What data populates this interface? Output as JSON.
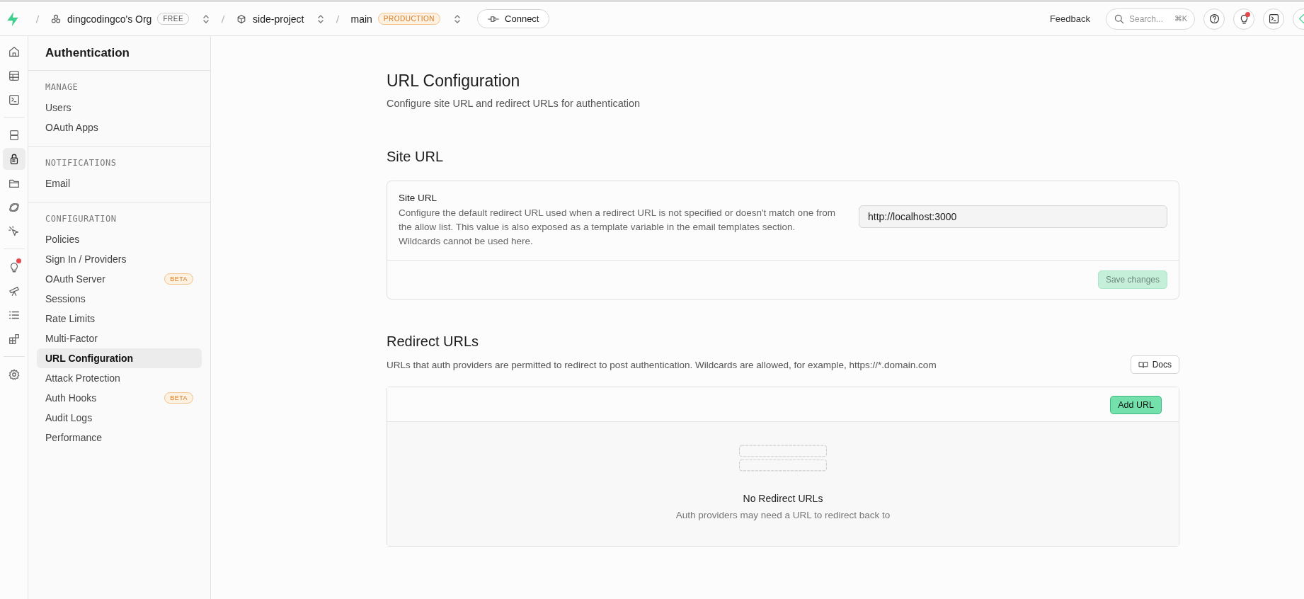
{
  "top_bar": {
    "breadcrumbs": [
      {
        "kind": "org",
        "label": "dingcodingco's Org",
        "badge": "FREE",
        "badge_warning": false
      },
      {
        "kind": "project",
        "label": "side-project"
      },
      {
        "kind": "branch",
        "label": "main",
        "badge": "PRODUCTION",
        "badge_warning": true
      }
    ],
    "connect_button": "Connect",
    "feedback": "Feedback",
    "search": {
      "placeholder": "Search...",
      "shortcut": "⌘K"
    },
    "icon_buttons": [
      {
        "kind": "help",
        "notification": false
      },
      {
        "kind": "bulb",
        "notification": true
      },
      {
        "kind": "terminal",
        "notification": false
      }
    ]
  },
  "rail": [
    {
      "items": [
        {
          "kind": "home",
          "selected": false
        },
        {
          "kind": "table",
          "selected": false
        },
        {
          "kind": "terminal",
          "selected": false
        }
      ]
    },
    {
      "items": [
        {
          "kind": "database",
          "selected": false
        },
        {
          "kind": "lock",
          "selected": true
        },
        {
          "kind": "folder",
          "selected": false
        },
        {
          "kind": "orbit",
          "selected": false
        },
        {
          "kind": "cursor",
          "selected": false
        }
      ]
    },
    {
      "items": [
        {
          "kind": "bulb",
          "selected": false,
          "notification": true
        },
        {
          "kind": "telescope",
          "selected": false
        },
        {
          "kind": "list",
          "selected": false
        },
        {
          "kind": "blocks",
          "selected": false
        }
      ]
    },
    {
      "items": [
        {
          "kind": "gear",
          "selected": false
        }
      ]
    }
  ],
  "sidebar": {
    "title": "Authentication",
    "sections": [
      {
        "heading": "MANAGE",
        "items": [
          {
            "label": "Users",
            "selected": false
          },
          {
            "label": "OAuth Apps",
            "selected": false
          }
        ]
      },
      {
        "heading": "NOTIFICATIONS",
        "items": [
          {
            "label": "Email",
            "selected": false
          }
        ]
      },
      {
        "heading": "CONFIGURATION",
        "items": [
          {
            "label": "Policies",
            "selected": false
          },
          {
            "label": "Sign In / Providers",
            "selected": false
          },
          {
            "label": "OAuth Server",
            "selected": false,
            "badge": "BETA"
          },
          {
            "label": "Sessions",
            "selected": false
          },
          {
            "label": "Rate Limits",
            "selected": false
          },
          {
            "label": "Multi-Factor",
            "selected": false
          },
          {
            "label": "URL Configuration",
            "selected": true
          },
          {
            "label": "Attack Protection",
            "selected": false
          },
          {
            "label": "Auth Hooks",
            "selected": false,
            "badge": "BETA"
          },
          {
            "label": "Audit Logs",
            "selected": false
          },
          {
            "label": "Performance",
            "selected": false
          }
        ]
      }
    ]
  },
  "page": {
    "title": "URL Configuration",
    "subtitle": "Configure site URL and redirect URLs for authentication",
    "site_url": {
      "heading": "Site URL",
      "label": "Site URL",
      "description": "Configure the default redirect URL used when a redirect URL is not specified or doesn't match one from the allow list. This value is also exposed as a template variable in the email templates section. Wildcards cannot be used here.",
      "value": "http://localhost:3000",
      "save_button": {
        "label": "Save changes",
        "disabled": true
      }
    },
    "redirect_urls": {
      "heading": "Redirect URLs",
      "description": "URLs that auth providers are permitted to redirect to post authentication. Wildcards are allowed, for example, https://*.domain.com",
      "docs_button": "Docs",
      "add_button": "Add URL",
      "empty_title": "No Redirect URLs",
      "empty_text": "Auth providers may need a URL to redirect back to"
    }
  }
}
